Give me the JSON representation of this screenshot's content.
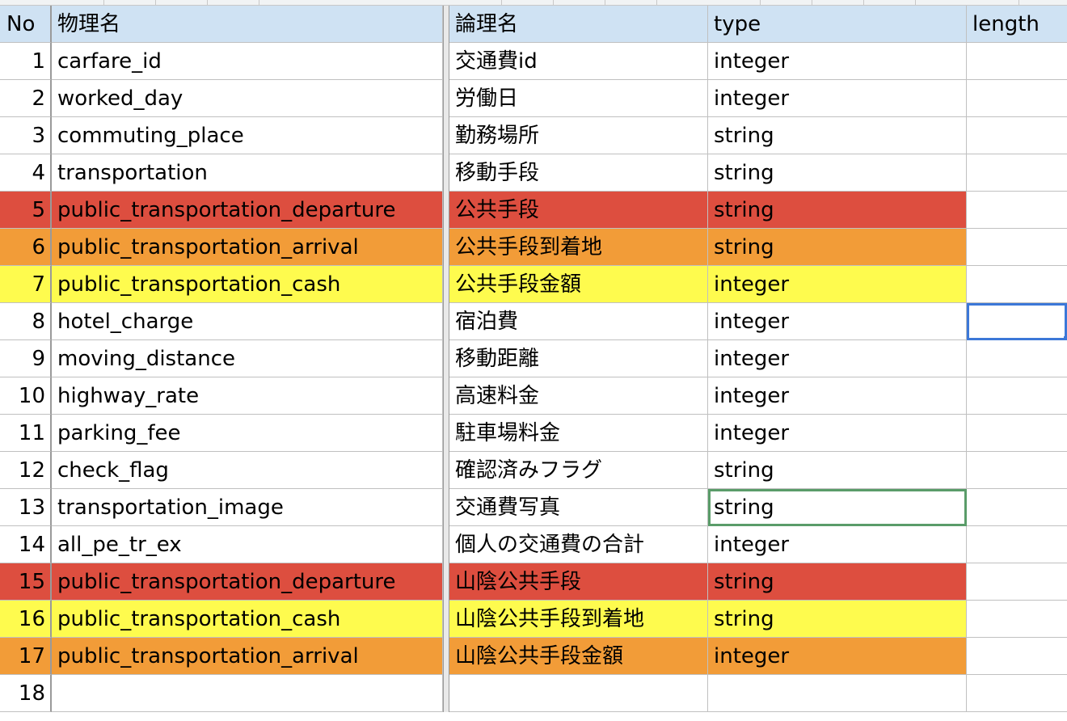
{
  "headers": {
    "no": "No",
    "physical": "物理名",
    "logical": "論理名",
    "type": "type",
    "length": "length"
  },
  "rows": [
    {
      "no": "1",
      "physical": "carfare_id",
      "logical": "交通費id",
      "type": "integer",
      "highlight": "none"
    },
    {
      "no": "2",
      "physical": "worked_day",
      "logical": "労働日",
      "type": "integer",
      "highlight": "none"
    },
    {
      "no": "3",
      "physical": "commuting_place",
      "logical": "勤務場所",
      "type": "string",
      "highlight": "none"
    },
    {
      "no": "4",
      "physical": "transportation",
      "logical": "移動手段",
      "type": "string",
      "highlight": "none"
    },
    {
      "no": "5",
      "physical": "public_transportation_departure",
      "logical": "公共手段",
      "type": "string",
      "highlight": "red"
    },
    {
      "no": "6",
      "physical": "public_transportation_arrival",
      "logical": "公共手段到着地",
      "type": "string",
      "highlight": "orange"
    },
    {
      "no": "7",
      "physical": "public_transportation_cash",
      "logical": "公共手段金額",
      "type": "integer",
      "highlight": "yellow"
    },
    {
      "no": "8",
      "physical": "hotel_charge",
      "logical": "宿泊費",
      "type": "integer",
      "highlight": "none"
    },
    {
      "no": "9",
      "physical": "moving_distance",
      "logical": "移動距離",
      "type": "integer",
      "highlight": "none"
    },
    {
      "no": "10",
      "physical": "highway_rate",
      "logical": "高速料金",
      "type": "integer",
      "highlight": "none"
    },
    {
      "no": "11",
      "physical": "parking_fee",
      "logical": "駐車場料金",
      "type": "integer",
      "highlight": "none"
    },
    {
      "no": "12",
      "physical": "check_flag",
      "logical": "確認済みフラグ",
      "type": "string",
      "highlight": "none"
    },
    {
      "no": "13",
      "physical": "transportation_image",
      "logical": "交通費写真",
      "type": "string",
      "highlight": "none"
    },
    {
      "no": "14",
      "physical": "all_pe_tr_ex",
      "logical": "個人の交通費の合計",
      "type": "integer",
      "highlight": "none"
    },
    {
      "no": "15",
      "physical": "public_transportation_departure",
      "logical": "山陰公共手段",
      "type": "string",
      "highlight": "red"
    },
    {
      "no": "16",
      "physical": "public_transportation_cash",
      "logical": "山陰公共手段到着地",
      "type": "string",
      "highlight": "yellow"
    },
    {
      "no": "17",
      "physical": "public_transportation_arrival",
      "logical": "山陰公共手段金額",
      "type": "integer",
      "highlight": "orange"
    },
    {
      "no": "18",
      "physical": "",
      "logical": "",
      "type": "",
      "highlight": "none"
    }
  ],
  "colors": {
    "header": "#cfe2f3",
    "red": "#dd4e3f",
    "orange": "#f29c38",
    "yellow": "#fefb4e",
    "selection_green": "#5a9c69",
    "selection_blue": "#3c78d8"
  }
}
